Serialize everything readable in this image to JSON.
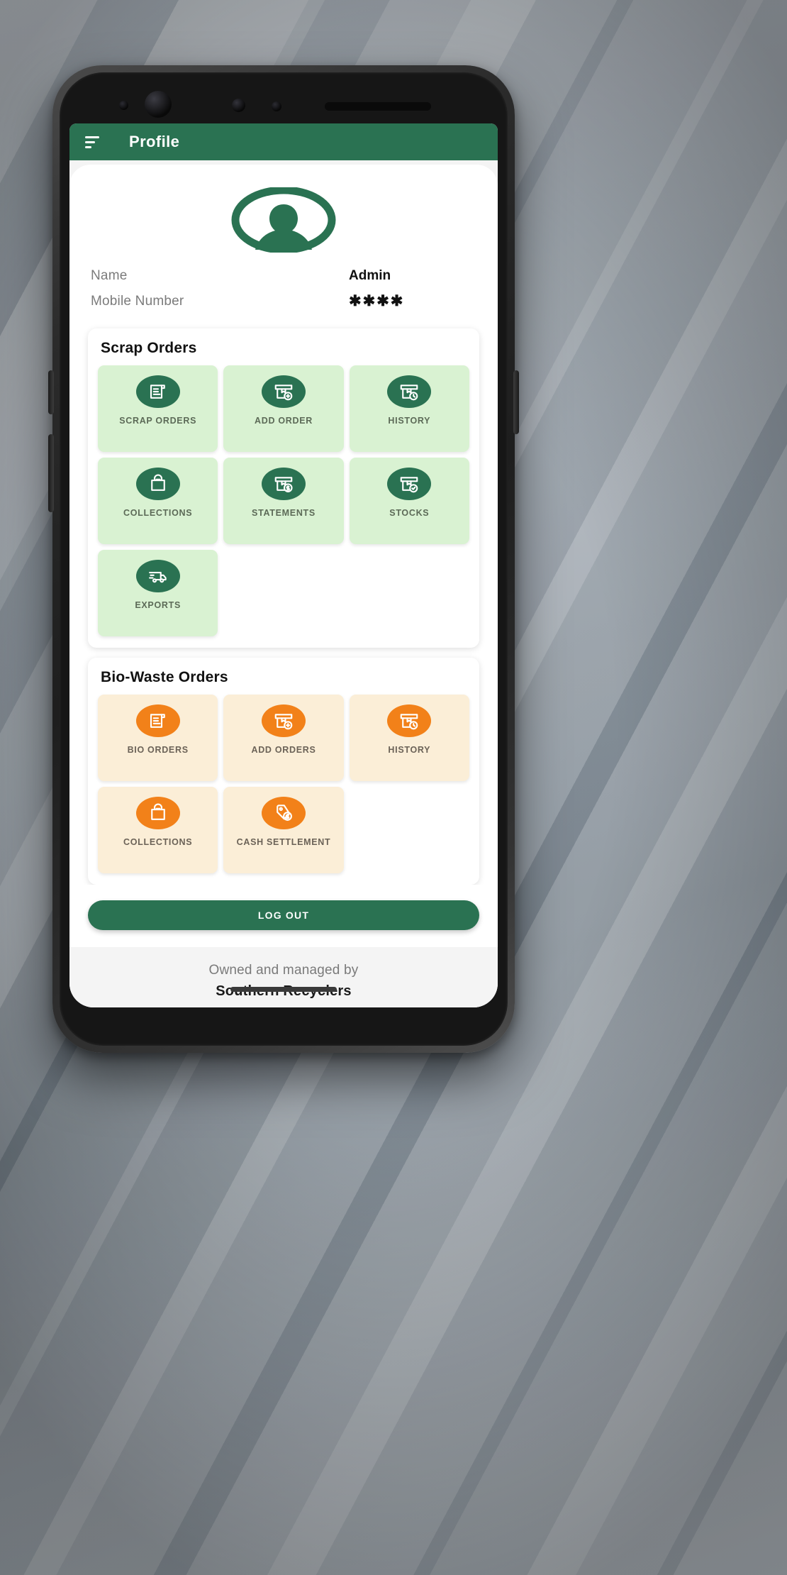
{
  "appbar": {
    "menu_icon": "hamburger-menu-icon",
    "title": "Profile"
  },
  "profile": {
    "avatar_icon": "user-avatar-icon",
    "rows": [
      {
        "label": "Name",
        "value": "Admin"
      },
      {
        "label": "Mobile Number",
        "value": "✱✱✱✱"
      }
    ]
  },
  "scrap_section": {
    "title": "Scrap Orders",
    "accent": "#2a7252",
    "tile_bg": "#d9f2d2",
    "tiles": [
      {
        "label": "SCRAP ORDERS",
        "icon": "document-list-icon"
      },
      {
        "label": "ADD ORDER",
        "icon": "box-plus-icon"
      },
      {
        "label": "HISTORY",
        "icon": "box-clock-icon"
      },
      {
        "label": "COLLECTIONS",
        "icon": "bag-minus-icon"
      },
      {
        "label": "STATEMENTS",
        "icon": "box-dollar-icon"
      },
      {
        "label": "STOCKS",
        "icon": "box-check-icon"
      },
      {
        "label": "EXPORTS",
        "icon": "delivery-truck-icon"
      }
    ]
  },
  "bio_section": {
    "title": "Bio-Waste Orders",
    "accent": "#f28119",
    "tile_bg": "#fbeed7",
    "tiles": [
      {
        "label": "BIO ORDERS",
        "icon": "document-list-icon"
      },
      {
        "label": "ADD ORDERS",
        "icon": "box-plus-icon"
      },
      {
        "label": "HISTORY",
        "icon": "box-clock-icon"
      },
      {
        "label": "COLLECTIONS",
        "icon": "bag-minus-icon"
      },
      {
        "label": "CASH SETTLEMENT",
        "icon": "tag-dollar-icon"
      }
    ]
  },
  "logout": {
    "label": "LOG OUT"
  },
  "footer": {
    "line1": "Owned and managed by",
    "line2": "Southern Recyclers"
  }
}
